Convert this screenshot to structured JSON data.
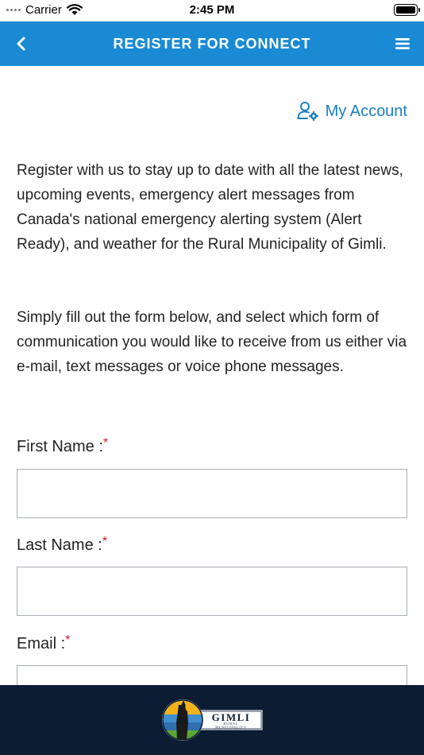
{
  "status": {
    "carrier": "Carrier",
    "time": "2:45 PM"
  },
  "nav": {
    "title": "REGISTER FOR CONNECT"
  },
  "account": {
    "label": "My Account"
  },
  "intro": {
    "paragraph1": "Register with us to stay up to date with all the latest news, upcoming events, emergency alert messages from Canada's national emergency alerting system (Alert Ready), and weather for the Rural Municipality of Gimli.",
    "paragraph2": "Simply fill out the form below, and select which form of communication you would like to receive from us either via e-mail, text messages or voice phone messages."
  },
  "form": {
    "first_name_label": "First Name :",
    "last_name_label": "Last Name :",
    "email_label": "Email :",
    "required_mark": "*",
    "first_name_value": "",
    "last_name_value": "",
    "email_value": ""
  },
  "footer": {
    "logo_text_main": "GIMLI",
    "logo_text_sub1": "RURAL",
    "logo_text_sub2": "MUNICIPALITY"
  },
  "colors": {
    "nav_bg": "#1a8ad4",
    "footer_bg": "#0b1c33",
    "link": "#1a7fc1",
    "required": "#d0161f"
  }
}
